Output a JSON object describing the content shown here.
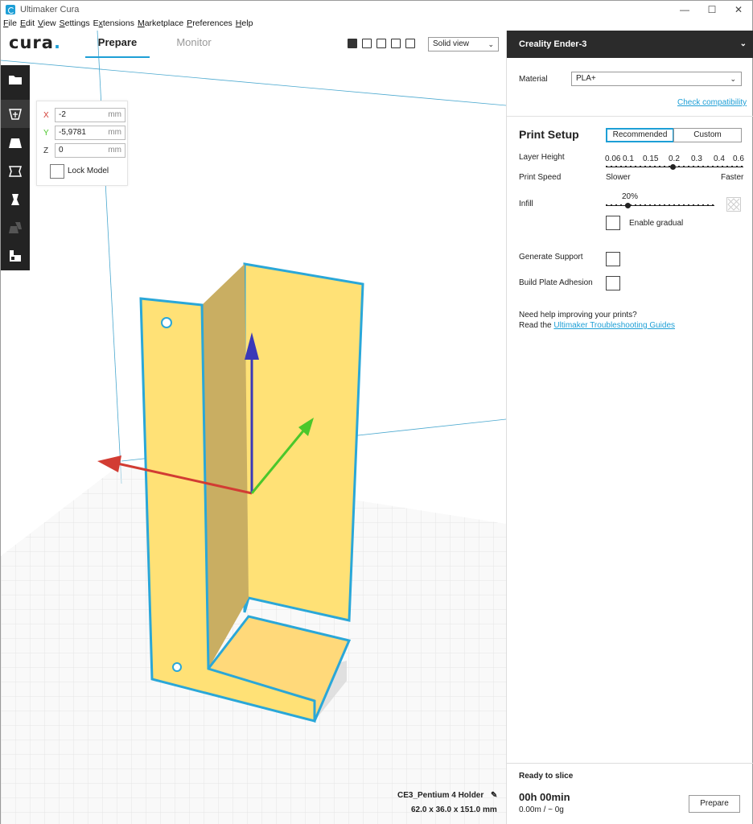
{
  "window": {
    "title": "Ultimaker Cura"
  },
  "menu": [
    {
      "pre": "",
      "u": "F",
      "post": "ile"
    },
    {
      "pre": "",
      "u": "E",
      "post": "dit"
    },
    {
      "pre": "",
      "u": "V",
      "post": "iew"
    },
    {
      "pre": "",
      "u": "S",
      "post": "ettings"
    },
    {
      "pre": "E",
      "u": "x",
      "post": "tensions"
    },
    {
      "pre": "",
      "u": "M",
      "post": "arketplace"
    },
    {
      "pre": "",
      "u": "P",
      "post": "references"
    },
    {
      "pre": "",
      "u": "H",
      "post": "elp"
    }
  ],
  "logo": {
    "text": "cura",
    "dot": "."
  },
  "tabs": {
    "prepare": "Prepare",
    "monitor": "Monitor"
  },
  "view_select": {
    "value": "Solid view"
  },
  "move_panel": {
    "x_label": "X",
    "x_value": "-2",
    "y_label": "Y",
    "y_value": "-5,9781",
    "z_label": "Z",
    "z_value": "0",
    "unit": "mm",
    "lock_label": "Lock Model"
  },
  "side": {
    "printer": "Creality Ender-3",
    "material_label": "Material",
    "material_value": "PLA+",
    "check_compat": "Check compatibility",
    "print_setup": "Print Setup",
    "recommended": "Recommended",
    "custom": "Custom",
    "layer_height_label": "Layer Height",
    "layer_ticks": [
      "0.06",
      "0.1",
      "0.15",
      "0.2",
      "0.3",
      "0.4",
      "0.6"
    ],
    "layer_selected": "0.2",
    "print_speed_label": "Print Speed",
    "slower": "Slower",
    "faster": "Faster",
    "infill_label": "Infill",
    "infill_value": "20%",
    "infill_fraction": 0.2,
    "enable_gradual": "Enable gradual",
    "support_label": "Generate Support",
    "adhesion_label": "Build Plate Adhesion",
    "help_line1": "Need help improving your prints?",
    "help_line2": "Read the ",
    "help_link": "Ultimaker Troubleshooting Guides",
    "ready": "Ready to slice",
    "time": "00h 00min",
    "material_usage": "0.00m / ~ 0g",
    "prepare_button": "Prepare"
  },
  "model": {
    "name": "CE3_Pentium 4 Holder",
    "dims": "62.0 x 36.0 x 151.0 mm"
  },
  "colors": {
    "accent": "#1e9fd6",
    "model": "#ffe176",
    "outline": "#2aa7d8"
  }
}
